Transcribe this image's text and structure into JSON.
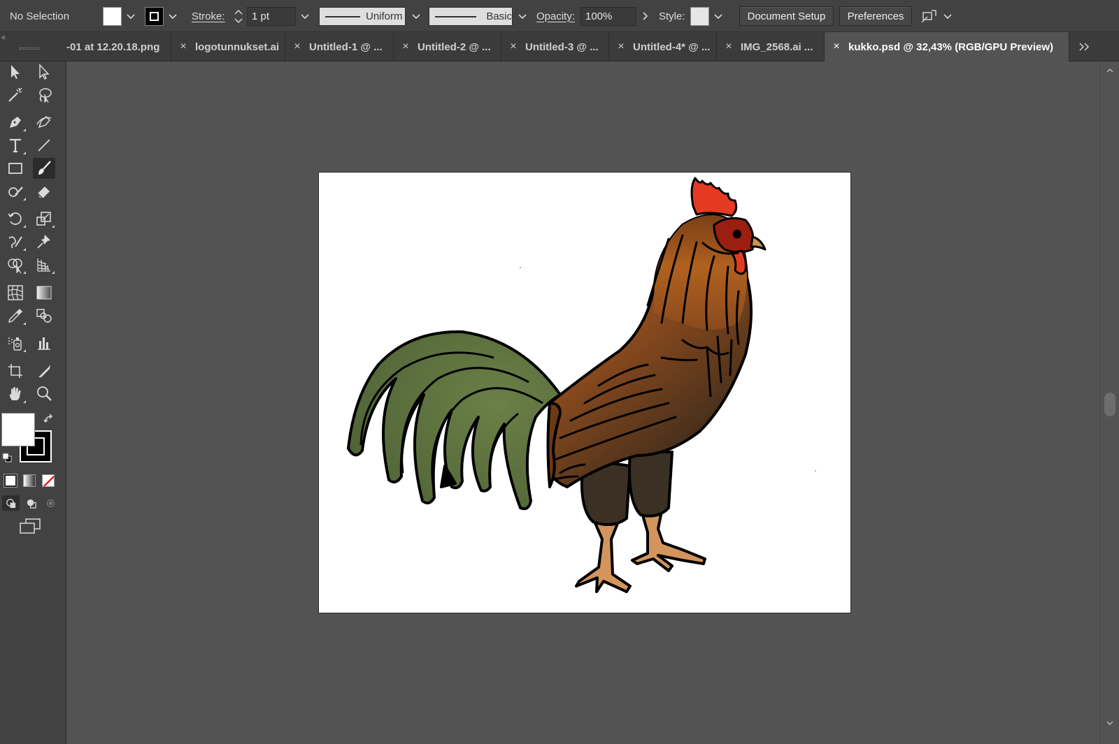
{
  "control_bar": {
    "selection_label": "No Selection",
    "stroke_label": "Stroke:",
    "stroke_weight": "1 pt",
    "variable_width_profile": "Uniform",
    "brush_definition": "Basic",
    "opacity_label": "Opacity:",
    "opacity_value": "100%",
    "style_label": "Style:",
    "document_setup_label": "Document Setup",
    "preferences_label": "Preferences"
  },
  "tabs": [
    {
      "label": "-01 at 12.20.18.png",
      "active": false
    },
    {
      "label": "logotunnukset.ai",
      "active": false
    },
    {
      "label": "Untitled-1 @ ...",
      "active": false
    },
    {
      "label": "Untitled-2 @ ...",
      "active": false
    },
    {
      "label": "Untitled-3 @ ...",
      "active": false
    },
    {
      "label": "Untitled-4* @ ...",
      "active": false
    },
    {
      "label": "IMG_2568.ai ...",
      "active": false
    },
    {
      "label": "kukko.psd @ 32,43% (RGB/GPU Preview)",
      "active": true
    }
  ],
  "tools": [
    {
      "name": "selection-tool",
      "icon": "arrow-icon"
    },
    {
      "name": "direct-selection-tool",
      "icon": "white-arrow-icon"
    },
    {
      "name": "magic-wand-tool",
      "icon": "magic-wand-icon"
    },
    {
      "name": "lasso-tool",
      "icon": "lasso-icon"
    },
    {
      "name": "pen-tool",
      "icon": "pen-icon"
    },
    {
      "name": "curvature-tool",
      "icon": "curvature-icon"
    },
    {
      "name": "type-tool",
      "icon": "type-icon"
    },
    {
      "name": "line-segment-tool",
      "icon": "line-icon"
    },
    {
      "name": "rectangle-tool",
      "icon": "rectangle-icon"
    },
    {
      "name": "paintbrush-tool",
      "icon": "paintbrush-icon",
      "active": true
    },
    {
      "name": "shaper-tool",
      "icon": "shaper-icon"
    },
    {
      "name": "eraser-tool",
      "icon": "eraser-icon"
    },
    {
      "name": "rotate-tool",
      "icon": "rotate-icon"
    },
    {
      "name": "scale-tool",
      "icon": "scale-icon"
    },
    {
      "name": "warp-tool",
      "icon": "warp-icon"
    },
    {
      "name": "puppet-warp-tool",
      "icon": "pin-icon"
    },
    {
      "name": "shape-builder-tool",
      "icon": "shape-builder-icon"
    },
    {
      "name": "perspective-grid-tool",
      "icon": "perspective-icon"
    },
    {
      "name": "mesh-tool",
      "icon": "mesh-icon"
    },
    {
      "name": "gradient-tool",
      "icon": "gradient-icon"
    },
    {
      "name": "eyedropper-tool",
      "icon": "eyedropper-icon"
    },
    {
      "name": "blend-tool",
      "icon": "blend-icon"
    },
    {
      "name": "symbol-sprayer-tool",
      "icon": "symbol-sprayer-icon"
    },
    {
      "name": "column-graph-tool",
      "icon": "graph-icon"
    },
    {
      "name": "artboard-tool",
      "icon": "artboard-icon"
    },
    {
      "name": "slice-tool",
      "icon": "slice-icon"
    },
    {
      "name": "hand-tool",
      "icon": "hand-icon"
    },
    {
      "name": "zoom-tool",
      "icon": "zoom-icon"
    }
  ],
  "colors": {
    "fill": "#ffffff",
    "stroke": "#000000",
    "ui_dark": "#424242",
    "canvas": "#535353"
  }
}
